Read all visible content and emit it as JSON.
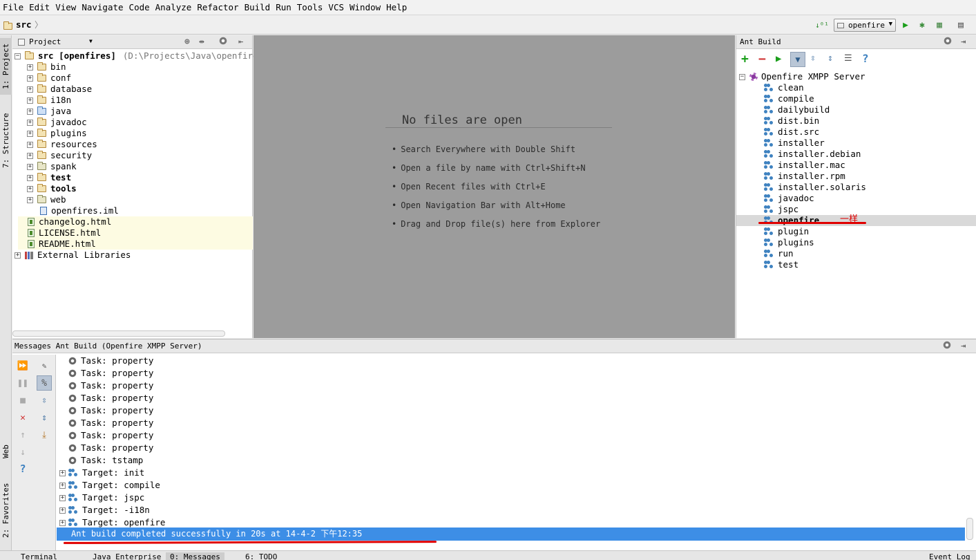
{
  "menu": [
    "File",
    "Edit",
    "View",
    "Navigate",
    "Code",
    "Analyze",
    "Refactor",
    "Build",
    "Run",
    "Tools",
    "VCS",
    "Window",
    "Help"
  ],
  "breadcrumb": {
    "label": "src",
    "sep": "〉"
  },
  "run_config": {
    "selected": "openfire"
  },
  "side_tabs": {
    "project": "1: Project",
    "structure": "7: Structure",
    "web": "Web",
    "favorites": "2: Favorites"
  },
  "project": {
    "header": "Project",
    "root_name": "src [openfires]",
    "root_path": "(D:\\Projects\\Java\\openfires",
    "items": [
      {
        "label": "bin",
        "kind": "folder"
      },
      {
        "label": "conf",
        "kind": "folder"
      },
      {
        "label": "database",
        "kind": "folder"
      },
      {
        "label": "i18n",
        "kind": "folder"
      },
      {
        "label": "java",
        "kind": "folder-blue"
      },
      {
        "label": "javadoc",
        "kind": "folder"
      },
      {
        "label": "plugins",
        "kind": "folder"
      },
      {
        "label": "resources",
        "kind": "folder"
      },
      {
        "label": "security",
        "kind": "folder"
      },
      {
        "label": "spank",
        "kind": "folder-pkg"
      },
      {
        "label": "test",
        "kind": "folder-bold"
      },
      {
        "label": "tools",
        "kind": "folder-bold"
      },
      {
        "label": "web",
        "kind": "folder-pkg"
      }
    ],
    "iml_file": "openfires.iml",
    "html_files": [
      "changelog.html",
      "LICENSE.html",
      "README.html"
    ],
    "external_libraries": "External Libraries"
  },
  "editor": {
    "empty_title": "No files are open",
    "hints": [
      "Search Everywhere with Double Shift",
      "Open a file by name with Ctrl+Shift+N",
      "Open Recent files with Ctrl+E",
      "Open Navigation Bar with Alt+Home",
      "Drag and Drop file(s) here from Explorer"
    ]
  },
  "ant_build": {
    "header": "Ant Build",
    "root": "Openfire XMPP Server",
    "targets": [
      "clean",
      "compile",
      "dailybuild",
      "dist.bin",
      "dist.src",
      "installer",
      "installer.debian",
      "installer.mac",
      "installer.rpm",
      "installer.solaris",
      "javadoc",
      "jspc",
      "openfire",
      "plugin",
      "plugins",
      "run",
      "test"
    ],
    "selected_target": "openfire",
    "annotation": "一样"
  },
  "messages": {
    "header": "Messages Ant Build (Openfire XMPP Server)",
    "rows": [
      {
        "text": "Task: property",
        "expandable": false
      },
      {
        "text": "Task: property",
        "expandable": false
      },
      {
        "text": "Task: property",
        "expandable": false
      },
      {
        "text": "Task: property",
        "expandable": false
      },
      {
        "text": "Task: property",
        "expandable": false
      },
      {
        "text": "Task: property",
        "expandable": false
      },
      {
        "text": "Task: property",
        "expandable": false
      },
      {
        "text": "Task: property",
        "expandable": false
      },
      {
        "text": "Task: tstamp",
        "expandable": false
      },
      {
        "text": "Target: init",
        "expandable": true
      },
      {
        "text": "Target: compile",
        "expandable": true
      },
      {
        "text": "Target: jspc",
        "expandable": true
      },
      {
        "text": "Target: -i18n",
        "expandable": true
      },
      {
        "text": "Target: openfire",
        "expandable": true
      }
    ],
    "status_line": "Ant build completed successfully in 20s at 14-4-2 下午12:35"
  },
  "bottom_tabs": [
    "Terminal",
    "Java Enterprise",
    "0: Messages",
    "6: TODO",
    "Event Log"
  ],
  "colors": {
    "selection": "#3d8ee6",
    "annotation_red": "#e00000",
    "editor_bg": "#9c9c9c",
    "highlight_row": "#fdfbe2"
  }
}
